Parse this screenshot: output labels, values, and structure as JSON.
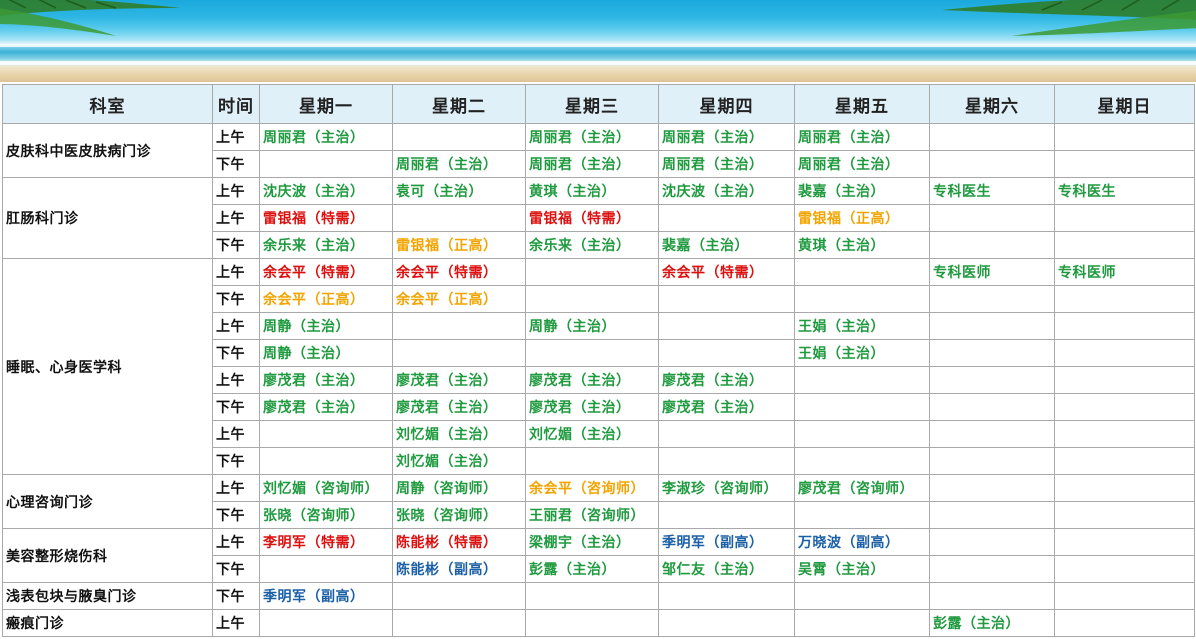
{
  "header": {
    "dept": "科室",
    "time": "时间",
    "days": [
      "星期一",
      "星期二",
      "星期三",
      "星期四",
      "星期五",
      "星期六",
      "星期日"
    ]
  },
  "colors": {
    "green": "#1f9a3f",
    "red": "#dd1010",
    "orange": "#f2a400",
    "blue": "#1b5fa6",
    "header_bg": "#dff0f8"
  },
  "rows": [
    {
      "dept": "皮肤科中医皮肤病门诊",
      "span": 2,
      "time": "上午",
      "cells": [
        [
          "周丽君（主治）",
          "green"
        ],
        [
          "",
          ""
        ],
        [
          "周丽君（主治）",
          "green"
        ],
        [
          "周丽君（主治）",
          "green"
        ],
        [
          "周丽君（主治）",
          "green"
        ],
        [
          "",
          ""
        ],
        [
          "",
          ""
        ]
      ]
    },
    {
      "time": "下午",
      "cells": [
        [
          "",
          ""
        ],
        [
          "周丽君（主治）",
          "green"
        ],
        [
          "周丽君（主治）",
          "green"
        ],
        [
          "周丽君（主治）",
          "green"
        ],
        [
          "周丽君（主治）",
          "green"
        ],
        [
          "",
          ""
        ],
        [
          "",
          ""
        ]
      ]
    },
    {
      "dept": "肛肠科门诊",
      "span": 3,
      "time": "上午",
      "cells": [
        [
          "沈庆波（主治）",
          "green"
        ],
        [
          "袁可（主治）",
          "green"
        ],
        [
          "黄琪（主治）",
          "green"
        ],
        [
          "沈庆波（主治）",
          "green"
        ],
        [
          "裴嘉（主治）",
          "green"
        ],
        [
          "专科医生",
          "green"
        ],
        [
          "专科医生",
          "green"
        ]
      ]
    },
    {
      "time": "上午",
      "cells": [
        [
          "雷银福（特需）",
          "red"
        ],
        [
          "",
          ""
        ],
        [
          "雷银福（特需）",
          "red"
        ],
        [
          "",
          ""
        ],
        [
          "雷银福（正高）",
          "orange"
        ],
        [
          "",
          ""
        ],
        [
          "",
          ""
        ]
      ]
    },
    {
      "time": "下午",
      "cells": [
        [
          "余乐来（主治）",
          "green"
        ],
        [
          "雷银福（正高）",
          "orange"
        ],
        [
          "余乐来（主治）",
          "green"
        ],
        [
          "裴嘉（主治）",
          "green"
        ],
        [
          "黄琪（主治）",
          "green"
        ],
        [
          "",
          ""
        ],
        [
          "",
          ""
        ]
      ]
    },
    {
      "dept": "睡眠、心身医学科",
      "span": 8,
      "time": "上午",
      "cells": [
        [
          "余会平（特需）",
          "red"
        ],
        [
          "余会平（特需）",
          "red"
        ],
        [
          "",
          ""
        ],
        [
          "余会平（特需）",
          "red"
        ],
        [
          "",
          ""
        ],
        [
          "专科医师",
          "green"
        ],
        [
          "专科医师",
          "green"
        ]
      ]
    },
    {
      "time": "下午",
      "cells": [
        [
          "余会平（正高）",
          "orange"
        ],
        [
          "余会平（正高）",
          "orange"
        ],
        [
          "",
          ""
        ],
        [
          "",
          ""
        ],
        [
          "",
          ""
        ],
        [
          "",
          ""
        ],
        [
          "",
          ""
        ]
      ]
    },
    {
      "time": "上午",
      "cells": [
        [
          "周静（主治）",
          "green"
        ],
        [
          "",
          ""
        ],
        [
          "周静（主治）",
          "green"
        ],
        [
          "",
          ""
        ],
        [
          "王娟（主治）",
          "green"
        ],
        [
          "",
          ""
        ],
        [
          "",
          ""
        ]
      ]
    },
    {
      "time": "下午",
      "cells": [
        [
          "周静（主治）",
          "green"
        ],
        [
          "",
          ""
        ],
        [
          "",
          ""
        ],
        [
          "",
          ""
        ],
        [
          "王娟（主治）",
          "green"
        ],
        [
          "",
          ""
        ],
        [
          "",
          ""
        ]
      ]
    },
    {
      "time": "上午",
      "cells": [
        [
          "廖茂君（主治）",
          "green"
        ],
        [
          "廖茂君（主治）",
          "green"
        ],
        [
          "廖茂君（主治）",
          "green"
        ],
        [
          "廖茂君（主治）",
          "green"
        ],
        [
          "",
          ""
        ],
        [
          "",
          ""
        ],
        [
          "",
          ""
        ]
      ]
    },
    {
      "time": "下午",
      "cells": [
        [
          "廖茂君（主治）",
          "green"
        ],
        [
          "廖茂君（主治）",
          "green"
        ],
        [
          "廖茂君（主治）",
          "green"
        ],
        [
          "廖茂君（主治）",
          "green"
        ],
        [
          "",
          ""
        ],
        [
          "",
          ""
        ],
        [
          "",
          ""
        ]
      ]
    },
    {
      "time": "上午",
      "cells": [
        [
          "",
          ""
        ],
        [
          "刘忆媚（主治）",
          "green"
        ],
        [
          "刘忆媚（主治）",
          "green"
        ],
        [
          "",
          ""
        ],
        [
          "",
          ""
        ],
        [
          "",
          ""
        ],
        [
          "",
          ""
        ]
      ]
    },
    {
      "time": "下午",
      "cells": [
        [
          "",
          ""
        ],
        [
          "刘忆媚（主治）",
          "green"
        ],
        [
          "",
          ""
        ],
        [
          "",
          ""
        ],
        [
          "",
          ""
        ],
        [
          "",
          ""
        ],
        [
          "",
          ""
        ]
      ]
    },
    {
      "dept": "心理咨询门诊",
      "span": 2,
      "time": "上午",
      "cells": [
        [
          "刘忆媚（咨询师）",
          "green"
        ],
        [
          "周静（咨询师）",
          "green"
        ],
        [
          "余会平（咨询师）",
          "orange"
        ],
        [
          "李淑珍（咨询师）",
          "green"
        ],
        [
          "廖茂君（咨询师）",
          "green"
        ],
        [
          "",
          ""
        ],
        [
          "",
          ""
        ]
      ]
    },
    {
      "time": "下午",
      "cells": [
        [
          "张晓（咨询师）",
          "green"
        ],
        [
          "张晓（咨询师）",
          "green"
        ],
        [
          "王丽君（咨询师）",
          "green"
        ],
        [
          "",
          ""
        ],
        [
          "",
          ""
        ],
        [
          "",
          ""
        ],
        [
          "",
          ""
        ]
      ]
    },
    {
      "dept": "美容整形烧伤科",
      "span": 2,
      "time": "上午",
      "cells": [
        [
          "李明军（特需）",
          "red"
        ],
        [
          "陈能彬（特需）",
          "red"
        ],
        [
          "梁棚宇（主治）",
          "green"
        ],
        [
          "季明军（副高）",
          "blue"
        ],
        [
          "万晓波（副高）",
          "blue"
        ],
        [
          "",
          ""
        ],
        [
          "",
          ""
        ]
      ]
    },
    {
      "time": "下午",
      "cells": [
        [
          "",
          ""
        ],
        [
          "陈能彬（副高）",
          "blue"
        ],
        [
          "彭露（主治）",
          "green"
        ],
        [
          "邹仁友（主治）",
          "green"
        ],
        [
          "吴霄（主治）",
          "green"
        ],
        [
          "",
          ""
        ],
        [
          "",
          ""
        ]
      ]
    },
    {
      "dept": "浅表包块与腋臭门诊",
      "span": 1,
      "time": "下午",
      "cells": [
        [
          "季明军（副高）",
          "blue"
        ],
        [
          "",
          ""
        ],
        [
          "",
          ""
        ],
        [
          "",
          ""
        ],
        [
          "",
          ""
        ],
        [
          "",
          ""
        ],
        [
          "",
          ""
        ]
      ]
    },
    {
      "dept": "瘢痕门诊",
      "span": 1,
      "time": "上午",
      "cells": [
        [
          "",
          ""
        ],
        [
          "",
          ""
        ],
        [
          "",
          ""
        ],
        [
          "",
          ""
        ],
        [
          "",
          ""
        ],
        [
          "彭露（主治）",
          "green"
        ],
        [
          "",
          ""
        ]
      ]
    }
  ]
}
